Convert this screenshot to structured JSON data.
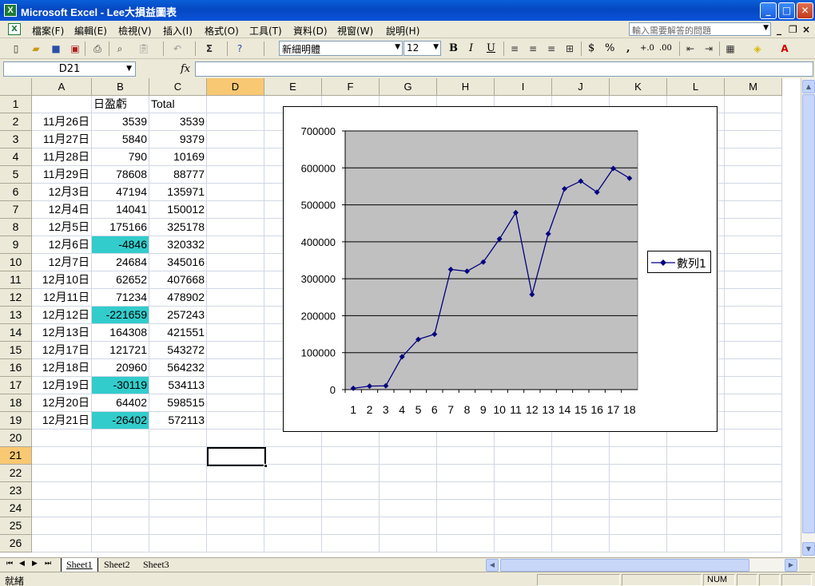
{
  "window": {
    "app_icon": "X",
    "title": "Microsoft Excel - Lee大損益圖表"
  },
  "menu": {
    "items": [
      "檔案(F)",
      "編輯(E)",
      "檢視(V)",
      "插入(I)",
      "格式(O)",
      "工具(T)",
      "資料(D)",
      "視窗(W)",
      "說明(H)"
    ],
    "help_placeholder": "輸入需要解答的問題"
  },
  "toolbar": {
    "sum_label": "Σ",
    "font_name": "新細明體",
    "font_size": "12",
    "bold": "B",
    "italic": "I",
    "underline": "U",
    "currency": "$",
    "percent": "%",
    "comma": ",",
    "inc_decimal": "+.0",
    "dec_decimal": ".00"
  },
  "formula_bar": {
    "name_box": "D21",
    "fx": "fx",
    "formula": ""
  },
  "columns": [
    "A",
    "B",
    "C",
    "D",
    "E",
    "F",
    "G",
    "H",
    "I",
    "J",
    "K",
    "L",
    "M"
  ],
  "active_column": "D",
  "active_row": 21,
  "header_row": {
    "a": "",
    "b": "日盈虧",
    "c": "Total"
  },
  "rows": [
    {
      "date": "11月26日",
      "daily": "3539",
      "total": "3539",
      "negative": false
    },
    {
      "date": "11月27日",
      "daily": "5840",
      "total": "9379",
      "negative": false
    },
    {
      "date": "11月28日",
      "daily": "790",
      "total": "10169",
      "negative": false
    },
    {
      "date": "11月29日",
      "daily": "78608",
      "total": "88777",
      "negative": false
    },
    {
      "date": "12月3日",
      "daily": "47194",
      "total": "135971",
      "negative": false
    },
    {
      "date": "12月4日",
      "daily": "14041",
      "total": "150012",
      "negative": false
    },
    {
      "date": "12月5日",
      "daily": "175166",
      "total": "325178",
      "negative": false
    },
    {
      "date": "12月6日",
      "daily": "-4846",
      "total": "320332",
      "negative": true
    },
    {
      "date": "12月7日",
      "daily": "24684",
      "total": "345016",
      "negative": false
    },
    {
      "date": "12月10日",
      "daily": "62652",
      "total": "407668",
      "negative": false
    },
    {
      "date": "12月11日",
      "daily": "71234",
      "total": "478902",
      "negative": false
    },
    {
      "date": "12月12日",
      "daily": "-221659",
      "total": "257243",
      "negative": true
    },
    {
      "date": "12月13日",
      "daily": "164308",
      "total": "421551",
      "negative": false
    },
    {
      "date": "12月17日",
      "daily": "121721",
      "total": "543272",
      "negative": false
    },
    {
      "date": "12月18日",
      "daily": "20960",
      "total": "564232",
      "negative": false
    },
    {
      "date": "12月19日",
      "daily": "-30119",
      "total": "534113",
      "negative": true
    },
    {
      "date": "12月20日",
      "daily": "64402",
      "total": "598515",
      "negative": false
    },
    {
      "date": "12月21日",
      "daily": "-26402",
      "total": "572113",
      "negative": true
    }
  ],
  "row_numbers": [
    1,
    2,
    3,
    4,
    5,
    6,
    7,
    8,
    9,
    10,
    11,
    12,
    13,
    14,
    15,
    16,
    17,
    18,
    19,
    20,
    21,
    22,
    23,
    24,
    25,
    26
  ],
  "colors": {
    "negative_fill": "#33cccc",
    "plot_area": "#c0c0c0",
    "series_line": "#000080",
    "active_header": "#f8c873"
  },
  "chart_data": {
    "type": "line",
    "x": [
      1,
      2,
      3,
      4,
      5,
      6,
      7,
      8,
      9,
      10,
      11,
      12,
      13,
      14,
      15,
      16,
      17,
      18
    ],
    "series": [
      {
        "name": "數列1",
        "values": [
          3539,
          9379,
          10169,
          88777,
          135971,
          150012,
          325178,
          320332,
          345016,
          407668,
          478902,
          257243,
          421551,
          543272,
          564232,
          534113,
          598515,
          572113
        ]
      }
    ],
    "y_ticks": [
      "0",
      "100000",
      "200000",
      "300000",
      "400000",
      "500000",
      "600000",
      "700000"
    ],
    "x_ticks": [
      "1",
      "2",
      "3",
      "4",
      "5",
      "6",
      "7",
      "8",
      "9",
      "10",
      "11",
      "12",
      "13",
      "14",
      "15",
      "16",
      "17",
      "18"
    ],
    "ylim": [
      0,
      700000
    ],
    "grid": true,
    "legend": "right",
    "marker": "diamond"
  },
  "sheets": {
    "tabs": [
      "Sheet1",
      "Sheet2",
      "Sheet3"
    ],
    "active": "Sheet1"
  },
  "status": {
    "text": "就緒",
    "num": "NUM"
  }
}
